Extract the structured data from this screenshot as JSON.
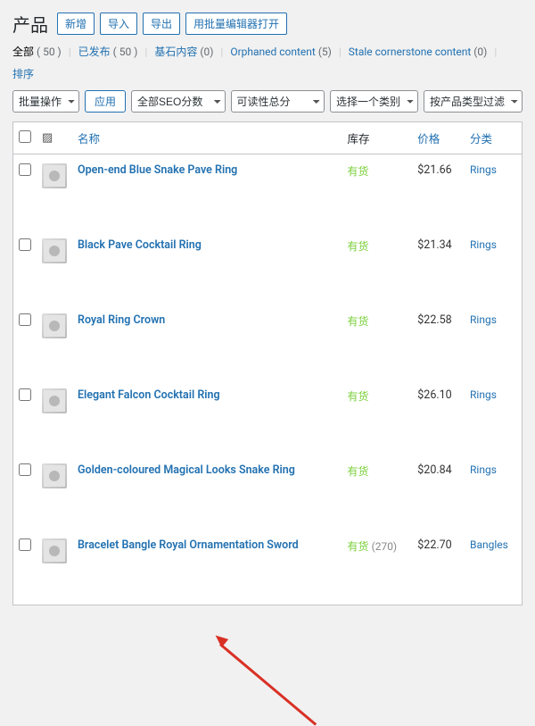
{
  "header": {
    "title": "产品",
    "buttons": {
      "add": "新增",
      "import": "导入",
      "export": "导出",
      "bulkedit": "用批量编辑器打开"
    }
  },
  "subfilters": {
    "all": "全部",
    "all_count": "( 50 )",
    "published": "已发布",
    "published_count": "( 50 )",
    "cornerstone": "基石内容",
    "cornerstone_count": "(0)",
    "orphaned": "Orphaned content",
    "orphaned_count": "(5)",
    "stale": "Stale cornerstone content",
    "stale_count": "(0)",
    "sort": "排序"
  },
  "toolbar": {
    "bulk_action": "批量操作",
    "apply": "应用",
    "seo_score": "全部SEO分数",
    "readability": "可读性总分",
    "category": "选择一个类别",
    "product_type": "按产品类型过滤"
  },
  "columns": {
    "name": "名称",
    "stock": "库存",
    "price": "价格",
    "category": "分类"
  },
  "products": [
    {
      "name": "Open-end Blue Snake Pave Ring",
      "stock": "有货",
      "stock_qty": "",
      "price": "$21.66",
      "cat": "Rings"
    },
    {
      "name": "Black Pave Cocktail Ring",
      "stock": "有货",
      "stock_qty": "",
      "price": "$21.34",
      "cat": "Rings"
    },
    {
      "name": "Royal Ring Crown",
      "stock": "有货",
      "stock_qty": "",
      "price": "$22.58",
      "cat": "Rings"
    },
    {
      "name": "Elegant Falcon Cocktail Ring",
      "stock": "有货",
      "stock_qty": "",
      "price": "$26.10",
      "cat": "Rings"
    },
    {
      "name": "Golden-coloured Magical Looks Snake Ring",
      "stock": "有货",
      "stock_qty": "",
      "price": "$20.84",
      "cat": "Rings"
    },
    {
      "name": "Bracelet Bangle Royal Ornamentation Sword",
      "stock": "有货",
      "stock_qty": "(270)",
      "price": "$22.70",
      "cat": "Bangles"
    }
  ]
}
